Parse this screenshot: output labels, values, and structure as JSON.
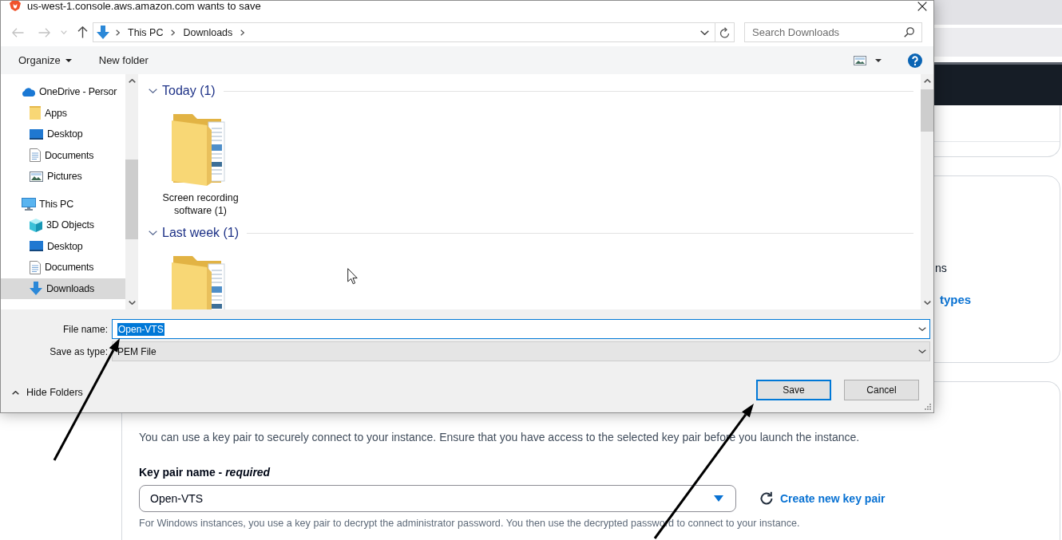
{
  "dialog": {
    "title": "us-west-1.console.aws.amazon.com wants to save",
    "address_bar": {
      "path": [
        "This PC",
        "Downloads"
      ]
    },
    "search": {
      "placeholder": "Search Downloads"
    },
    "toolbar": {
      "organize": "Organize",
      "new_folder": "New folder"
    },
    "navigation": [
      {
        "label": "OneDrive - Persor",
        "kind": "cloud",
        "selected": false,
        "children": [
          {
            "label": "Apps",
            "kind": "folder",
            "selected": false
          },
          {
            "label": "Desktop",
            "kind": "desktop",
            "selected": false
          },
          {
            "label": "Documents",
            "kind": "documents",
            "selected": false
          },
          {
            "label": "Pictures",
            "kind": "pictures",
            "selected": false
          }
        ]
      },
      {
        "label": "This PC",
        "kind": "computer",
        "selected": false,
        "children": [
          {
            "label": "3D Objects",
            "kind": "objects3d",
            "selected": false
          },
          {
            "label": "Desktop",
            "kind": "desktop",
            "selected": false
          },
          {
            "label": "Documents",
            "kind": "documents",
            "selected": false
          },
          {
            "label": "Downloads",
            "kind": "downloads",
            "selected": true
          }
        ]
      }
    ],
    "groups": [
      {
        "label": "Today (1)",
        "expanded": true,
        "items": [
          {
            "kind": "folder",
            "name": "Screen recording software (1)"
          }
        ]
      },
      {
        "label": "Last week (1)",
        "expanded": true,
        "items": [
          {
            "kind": "folder"
          }
        ]
      }
    ],
    "file_name": {
      "label": "File name:",
      "value": "Open-VTS",
      "text_selected": true
    },
    "save_as_type": {
      "label": "Save as type:",
      "value": "PEM File"
    },
    "hide_folders": {
      "label": "Hide Folders"
    },
    "buttons": [
      {
        "label": "Save",
        "default": true
      },
      {
        "label": "Cancel",
        "default": false
      }
    ]
  },
  "page": {
    "fragments": [
      {
        "kind": "text",
        "text": "ns"
      },
      {
        "kind": "link",
        "text": "types"
      }
    ],
    "key_pair": {
      "description": "You can use a key pair to securely connect to your instance. Ensure that you have access to the selected key pair before you launch the instance.",
      "label": "Key pair name - *required*",
      "value": "Open-VTS",
      "create_link": "Create new key pair",
      "help": "For Windows instances, you use a key pair to decrypt the administrator password. You then use the decrypted password to connect to your instance."
    }
  }
}
